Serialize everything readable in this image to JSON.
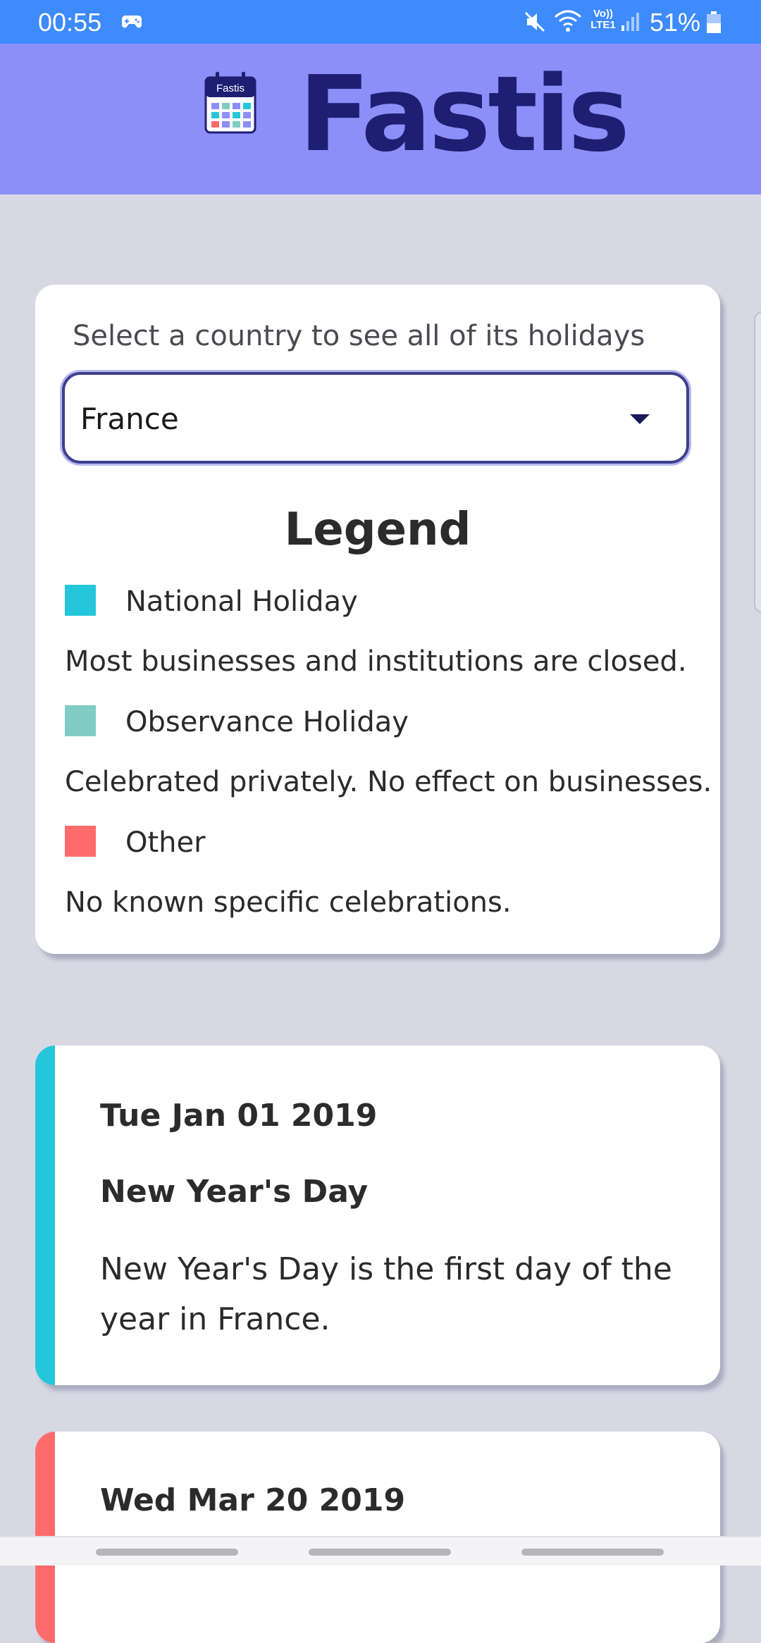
{
  "status_bar": {
    "time": "00:55",
    "lte_line1": "Vo))",
    "lte_line2": "LTE1",
    "battery_text": "51%",
    "icons": [
      "game-controller-icon",
      "mute-icon",
      "wifi-icon",
      "signal-icon",
      "battery-icon"
    ]
  },
  "header": {
    "logo_text": "Fastis",
    "title": "Fastis",
    "colors": {
      "header_bg": "#8b8ff7",
      "title": "#1e1f72"
    }
  },
  "country_select": {
    "prompt": "Select a country to see all of its holidays",
    "selected_value": "France"
  },
  "legend": {
    "title": "Legend",
    "items": [
      {
        "label": "National Holiday",
        "description": "Most businesses and institutions are closed.",
        "color": "#26c6da"
      },
      {
        "label": "Observance Holiday",
        "description": "Celebrated privately. No effect on businesses.",
        "color": "#80cbc4"
      },
      {
        "label": "Other",
        "description": "No known specific celebrations.",
        "color": "#ff6b6b"
      }
    ]
  },
  "holidays": [
    {
      "date": "Tue Jan 01 2019",
      "name": "New Year's Day",
      "description": "New Year's Day is the first day of the year in France.",
      "color": "#26c6da"
    },
    {
      "date": "Wed Mar 20 2019",
      "color": "#ff6b6b"
    }
  ]
}
